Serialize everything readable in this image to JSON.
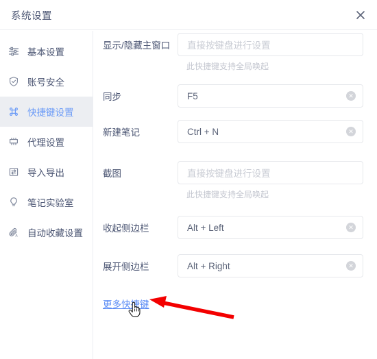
{
  "window": {
    "title": "系统设置",
    "close_icon": "close-icon"
  },
  "sidebar": {
    "items": [
      {
        "label": "基本设置",
        "icon": "sliders-icon",
        "selected": false
      },
      {
        "label": "账号安全",
        "icon": "shield-check-icon",
        "selected": false
      },
      {
        "label": "快捷键设置",
        "icon": "command-icon",
        "selected": true
      },
      {
        "label": "代理设置",
        "icon": "server-icon",
        "selected": false
      },
      {
        "label": "导入导出",
        "icon": "import-export-icon",
        "selected": false
      },
      {
        "label": "笔记实验室",
        "icon": "lightbulb-icon",
        "selected": false
      },
      {
        "label": "自动收藏设置",
        "icon": "paperclip-icon",
        "selected": false
      }
    ]
  },
  "shortcuts": {
    "placeholder": "直接按键盘进行设置",
    "global_hint": "此快捷键支持全局唤起",
    "clear_icon": "clear-icon",
    "rows": [
      {
        "label": "显示/隐藏主窗口",
        "value": "",
        "placeholder": "直接按键盘进行设置",
        "hint": "此快捷键支持全局唤起",
        "clearable": false
      },
      {
        "label": "同步",
        "value": "F5",
        "placeholder": "",
        "hint": "",
        "clearable": true
      },
      {
        "label": "新建笔记",
        "value": "Ctrl + N",
        "placeholder": "",
        "hint": "",
        "clearable": true
      },
      {
        "label": "截图",
        "value": "",
        "placeholder": "直接按键盘进行设置",
        "hint": "此快捷键支持全局唤起",
        "clearable": false
      },
      {
        "label": "收起侧边栏",
        "value": "Alt + Left",
        "placeholder": "",
        "hint": "",
        "clearable": true
      },
      {
        "label": "展开侧边栏",
        "value": "Alt + Right",
        "placeholder": "",
        "hint": "",
        "clearable": true
      }
    ],
    "more_link": "更多快捷键"
  },
  "annotation": {
    "arrow_color": "#f30000",
    "cursor": "pointing-hand-cursor"
  },
  "colors": {
    "accent": "#5b8cf5",
    "selected_bg": "#eceef2",
    "text": "#4a5472",
    "placeholder": "#c9ccd4",
    "border": "#e6e8ec"
  }
}
